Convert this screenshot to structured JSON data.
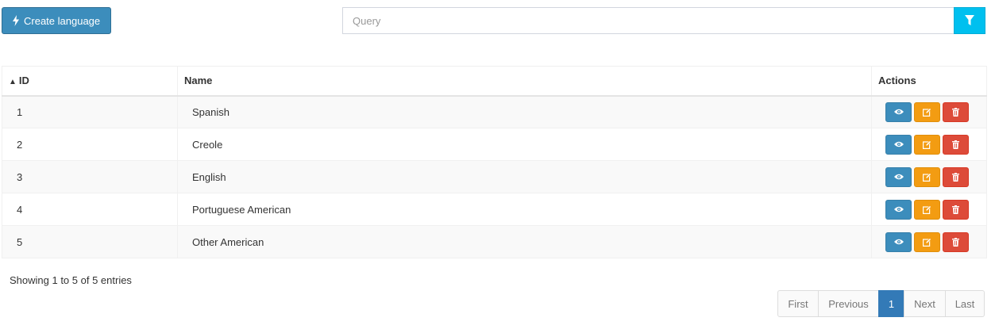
{
  "toolbar": {
    "create_label": "Create language",
    "create_icon": "bolt-icon",
    "search_placeholder": "Query",
    "search_value": "",
    "filter_icon": "filter-icon"
  },
  "table": {
    "columns": {
      "id": "ID",
      "id_sort_indicator": "▲",
      "name": "Name",
      "actions": "Actions"
    },
    "rows": [
      {
        "id": "1",
        "name": "Spanish"
      },
      {
        "id": "2",
        "name": "Creole"
      },
      {
        "id": "3",
        "name": "English"
      },
      {
        "id": "4",
        "name": "Portuguese American"
      },
      {
        "id": "5",
        "name": "Other American"
      }
    ],
    "row_actions": [
      "eye-icon",
      "edit-icon",
      "trash-icon"
    ]
  },
  "footer": {
    "info": "Showing 1 to 5 of 5 entries",
    "pagination": {
      "first": "First",
      "previous": "Previous",
      "current": "1",
      "next": "Next",
      "last": "Last"
    }
  },
  "colors": {
    "primary": "#3c8dbc",
    "info": "#00c0ef",
    "warning": "#f39c12",
    "danger": "#dd4b39",
    "page_active": "#337ab7"
  }
}
